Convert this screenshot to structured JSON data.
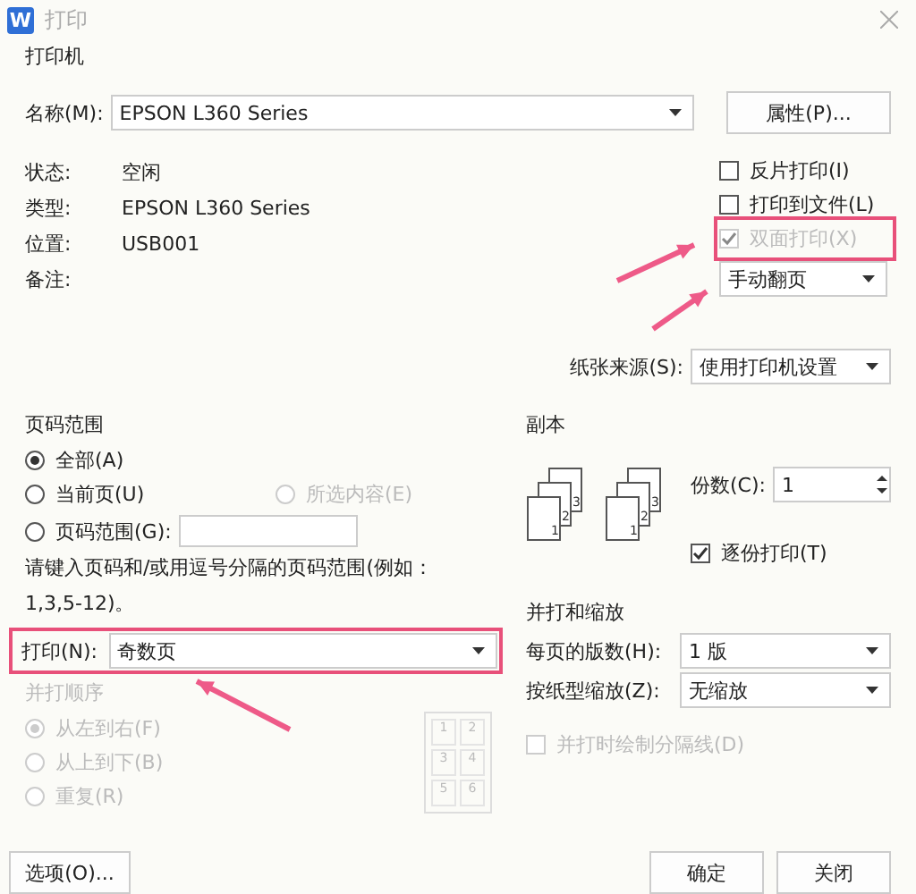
{
  "window": {
    "title": "打印",
    "app_badge": "W"
  },
  "printer": {
    "heading": "打印机",
    "name_label": "名称(M):",
    "name": "EPSON L360 Series",
    "properties_button": "属性(P)...",
    "info": [
      {
        "label": "状态:",
        "value": "空闲"
      },
      {
        "label": "类型:",
        "value": "EPSON L360 Series"
      },
      {
        "label": "位置:",
        "value": "USB001"
      },
      {
        "label": "备注:"
      }
    ],
    "options": [
      {
        "label": "反片打印(I)",
        "checked": false,
        "disabled": false,
        "highlighted": false
      },
      {
        "label": "打印到文件(L)",
        "checked": false,
        "disabled": false,
        "highlighted": false
      },
      {
        "label": "双面打印(X)",
        "checked": true,
        "disabled": true,
        "highlighted": true
      }
    ],
    "duplex_mode": "手动翻页",
    "paper_source": {
      "label": "纸张来源(S):",
      "value": "使用打印机设置"
    }
  },
  "page_range": {
    "heading": "页码范围",
    "choices": [
      {
        "label": "全部(A)",
        "selected": true,
        "disabled": false
      },
      {
        "label": "当前页(U)",
        "selected": false,
        "disabled": false
      },
      {
        "label": "所选内容(E)",
        "selected": false,
        "disabled": true
      },
      {
        "label": "页码范围(G):",
        "selected": false,
        "disabled": false
      }
    ],
    "hint": "请键入页码和/或用逗号分隔的页码范围(例如：1,3,5-12)。"
  },
  "print_select": {
    "label": "打印(N):",
    "value": "奇数页",
    "highlighted": true
  },
  "collate_order": {
    "heading": "并打顺序",
    "disabled": true,
    "choices": [
      {
        "label": "从左到右(F)",
        "selected": true
      },
      {
        "label": "从上到下(B)",
        "selected": false
      },
      {
        "label": "重复(R)",
        "selected": false
      }
    ],
    "grid": [
      "1",
      "2",
      "3",
      "4",
      "5",
      "6"
    ]
  },
  "copies": {
    "heading": "副本",
    "stacks": [
      [
        "1",
        "2",
        "3"
      ],
      [
        "1",
        "2",
        "3"
      ]
    ],
    "count_label": "份数(C):",
    "count": "1",
    "collate": {
      "label": "逐份打印(T)",
      "checked": true
    }
  },
  "scaling": {
    "heading": "并打和缩放",
    "pages_per_sheet_label": "每页的版数(H):",
    "pages_per_sheet": "1 版",
    "scale_label": "按纸型缩放(Z):",
    "scale": "无缩放",
    "draw_borders": {
      "label": "并打时绘制分隔线(D)",
      "checked": false,
      "disabled": true
    }
  },
  "buttons": [
    {
      "label": "选项(O)..."
    },
    {
      "label": "确定"
    },
    {
      "label": "关闭"
    }
  ]
}
